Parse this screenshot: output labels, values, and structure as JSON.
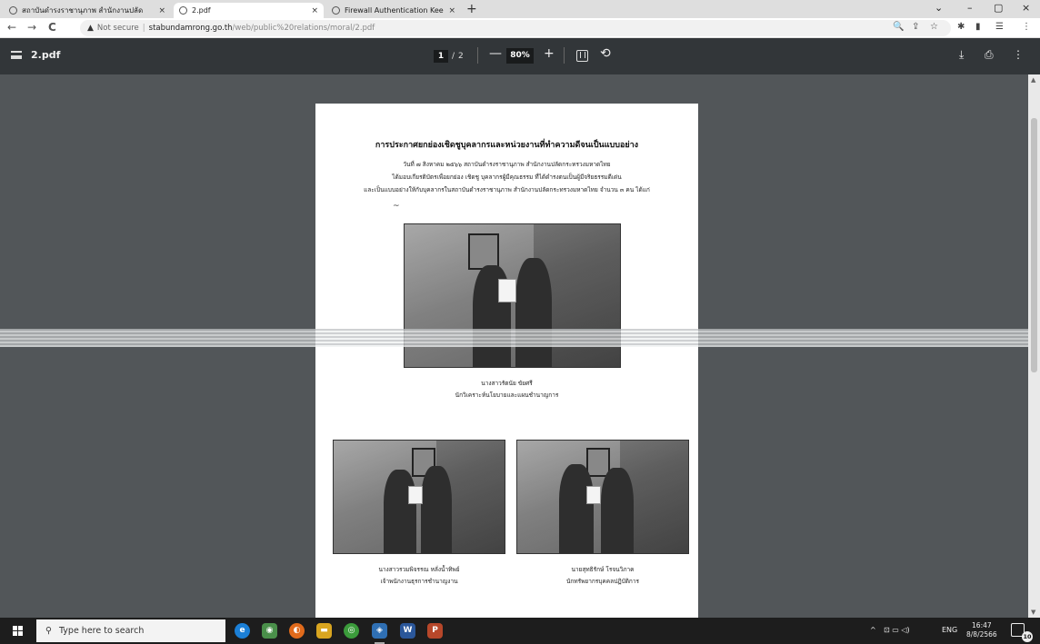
{
  "tabs": [
    {
      "title": "สถาบันดำรงราชานุภาพ สำนักงานปลัด",
      "close": "×",
      "active": false
    },
    {
      "title": "2.pdf",
      "close": "×",
      "active": true
    },
    {
      "title": "Firewall Authentication Keepalive",
      "close": "×",
      "active": false
    }
  ],
  "new_tab": "+",
  "window_controls": {
    "tab_search": "⌄",
    "minimize": "–",
    "maximize": "▢",
    "close": "×"
  },
  "nav": {
    "back": "←",
    "forward": "→",
    "reload": "C"
  },
  "address": {
    "warning_icon": "▲",
    "security_label": "Not secure",
    "separator": "|",
    "host": "stabundamrong.go.th",
    "path": "/web/public%20relations/moral/2.pdf"
  },
  "toolbar_icons": [
    "🔍",
    "⇪",
    "☆",
    "✱",
    "▮",
    "☰",
    "⋮"
  ],
  "pdf": {
    "title": "2.pdf",
    "current_page": "1",
    "page_sep": "/",
    "total_pages": "2",
    "zoom_out": "—",
    "zoom": "80%",
    "zoom_in": "+",
    "rotate": "⟲",
    "download": "⤓",
    "print": "⎙",
    "more": "⋮"
  },
  "document": {
    "heading": "การประกาศยกย่องเชิดชูบุคลากรและหน่วยงานที่ทำความดีจนเป็นแบบอย่าง",
    "lines": [
      "วันที่ ๗ สิงหาคม ๒๕๖๖ สถาบันดำรงราชานุภาพ สำนักงานปลัดกระทรวงมหาดไทย",
      "ได้มอบเกียรติบัตรเพื่อยกย่อง เชิดชู บุคลากรผู้มีคุณธรรม ที่ได้ดำรงตนเป็นผู้มีจริยธรรมดีเด่น",
      "และเป็นแบบอย่างให้กับบุคลากรในสถาบันดำรงราชานุภาพ สำนักงานปลัดกระทรวงมหาดไทย จำนวน ๓ คน ได้แก่"
    ],
    "dash": "~",
    "captions": [
      {
        "name": "นางสาวรัตนัย ขัยศรี",
        "position": "นักวิเคราะห์นโยบายและแผนชำนาญการ"
      },
      {
        "name": "นางสาวรวมพิจรรณ หลั่งน้ำทิพย์",
        "position": "เจ้าพนักงานธุรการชำนาญงาน"
      },
      {
        "name": "นายสุทธิรักษ์ โรจนวิภาค",
        "position": "นักทรัพยากรบุคคลปฏิบัติการ"
      }
    ]
  },
  "taskbar": {
    "search_icon": "⚲",
    "search_placeholder": "Type here to search",
    "apps": [
      {
        "name": "edge",
        "glyph": "e",
        "color": "#1b7fd6"
      },
      {
        "name": "chat",
        "glyph": "◉",
        "color": "#4a8f4a"
      },
      {
        "name": "firefox",
        "glyph": "◐",
        "color": "#e06a1b"
      },
      {
        "name": "file-explorer",
        "glyph": "▬",
        "color": "#d9a520"
      },
      {
        "name": "chrome",
        "glyph": "◎",
        "color": "#3b9b3b"
      },
      {
        "name": "photos",
        "glyph": "◈",
        "color": "#2f6fb3"
      },
      {
        "name": "word",
        "glyph": "W",
        "color": "#2b579a"
      },
      {
        "name": "powerpoint",
        "glyph": "P",
        "color": "#b7472a"
      }
    ],
    "tray": {
      "chevron": "^",
      "icons": "⊡ ▭ ◁)",
      "language": "ENG"
    },
    "time": "16:47",
    "date": "8/8/2566",
    "notification_count": "10"
  }
}
